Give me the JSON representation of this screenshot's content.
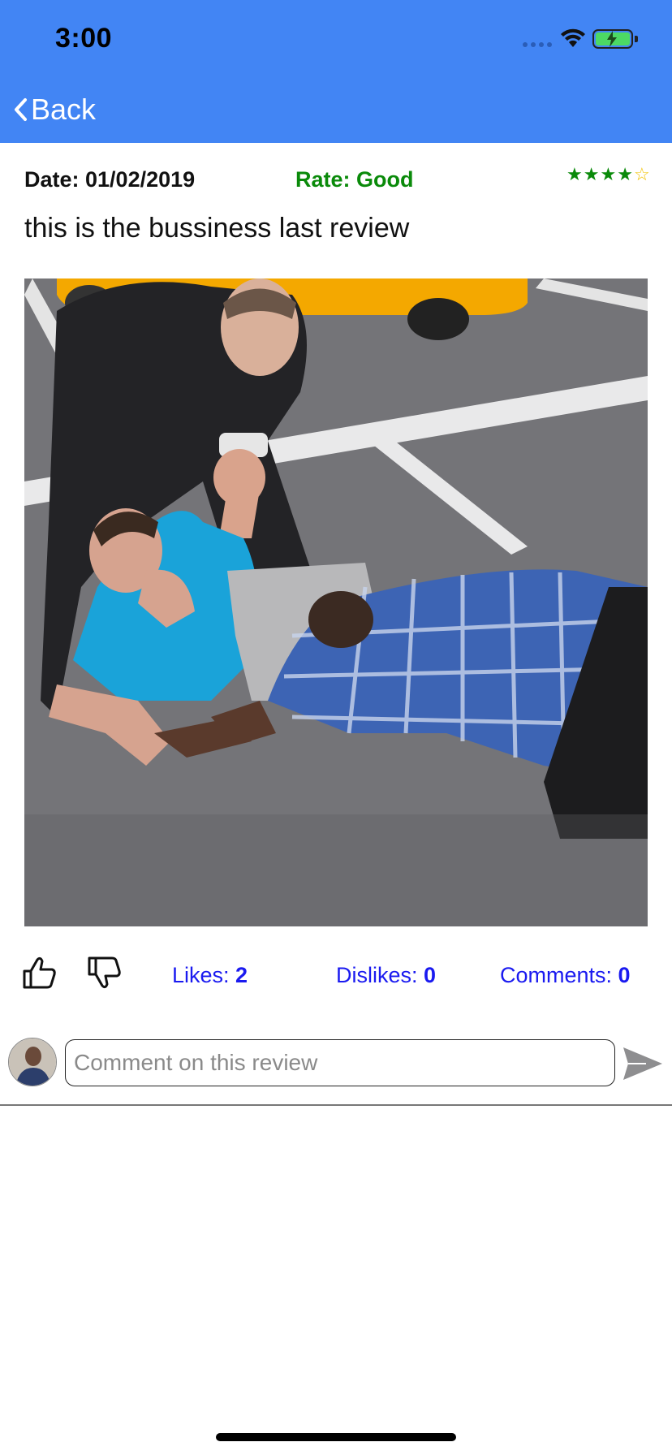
{
  "status_bar": {
    "time": "3:00",
    "icons": [
      "signal-dots-icon",
      "wifi-icon",
      "battery-charging-icon"
    ]
  },
  "nav": {
    "back_label": "Back",
    "background_color": "#4285f4"
  },
  "review": {
    "date_label": "Date: 01/02/2019",
    "rate_label": "Rate: Good",
    "rating": {
      "value": 4,
      "max": 5
    },
    "text": "this is the bussiness last review",
    "photo_icon": "review-photo"
  },
  "stats": {
    "likes_label": "Likes: ",
    "likes_value": "2",
    "dislikes_label": "Dislikes: ",
    "dislikes_value": "0",
    "comments_label": "Comments: ",
    "comments_value": "0"
  },
  "comment": {
    "placeholder": "Comment on this review",
    "value": ""
  },
  "colors": {
    "rate_green": "#0a8a0a",
    "stat_blue": "#1a1af0",
    "star_empty": "#f2c200"
  }
}
